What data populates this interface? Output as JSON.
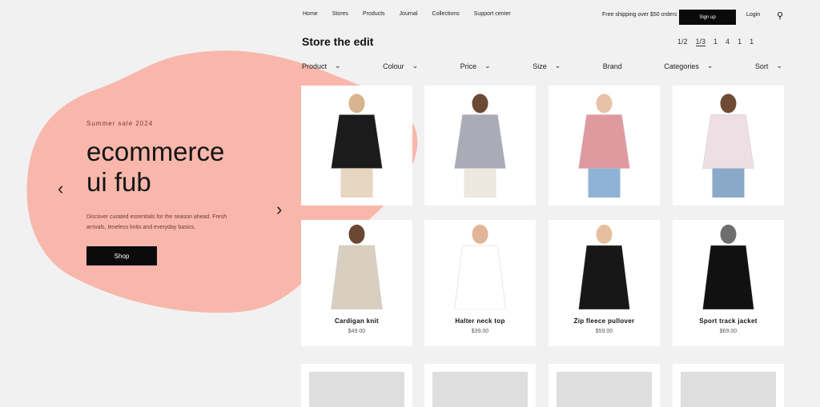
{
  "nav": {
    "links": [
      "Home",
      "Stores",
      "Products",
      "Journal",
      "Collections",
      "Support center"
    ],
    "promo": "Free shipping over $50 orders",
    "signup_label": "Sign up",
    "account_label": "Login"
  },
  "hero": {
    "kicker": "Summer sale 2024",
    "title_line1": "ecommerce",
    "title_line2": "ui fub",
    "desc": "Discover curated essentials for the season ahead. Fresh arrivals, timeless knits and everyday basics.",
    "cta_label": "Shop"
  },
  "section_title": "Store the edit",
  "toolbar": [
    "1/2",
    "1/3",
    "1",
    "4",
    "1",
    "1"
  ],
  "filters": [
    "Product",
    "Colour",
    "Price",
    "Size",
    "Brand",
    "Categories",
    "Sort"
  ],
  "products": [
    {
      "name": "",
      "price": "",
      "color": "#1b1b1b",
      "skin": "#d7b48e",
      "pants": "#e7d6c2"
    },
    {
      "name": "",
      "price": "",
      "color": "#a9acb6",
      "skin": "#6b4a33",
      "pants": "#ece7df"
    },
    {
      "name": "",
      "price": "",
      "color": "#df9aa0",
      "skin": "#e8c2a6",
      "pants": "#8fb3d6"
    },
    {
      "name": "",
      "price": "",
      "color": "#eddfe3",
      "skin": "#6e4a33",
      "pants": "#8aa9c8"
    },
    {
      "name": "Cardigan knit",
      "price": "$49.00",
      "color": "#d8cfc1",
      "skin": "#6b4834",
      "pants": "#d8cfc1"
    },
    {
      "name": "Halter neck top",
      "price": "$39.00",
      "color": "#ffffff",
      "skin": "#e2b596",
      "pants": "#ffffff"
    },
    {
      "name": "Zip fleece pullover",
      "price": "$59.00",
      "color": "#171717",
      "skin": "#e6bf9f",
      "pants": "#171717"
    },
    {
      "name": "Sport track jacket",
      "price": "$69.00",
      "color": "#111111",
      "skin": "#6e6e6e",
      "pants": "#111111"
    }
  ],
  "colors": {
    "blob": "#f9b7ac",
    "dark": "#0b0b0b"
  }
}
